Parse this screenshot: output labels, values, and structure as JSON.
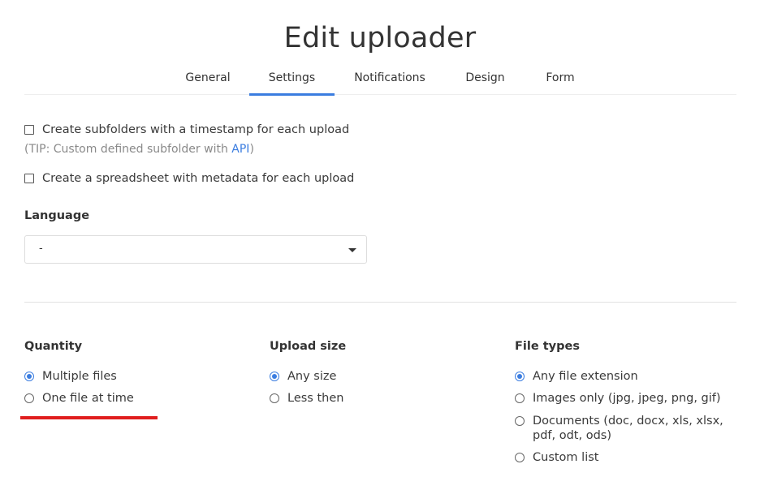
{
  "page": {
    "title": "Edit uploader"
  },
  "tabs": [
    {
      "label": "General",
      "active": false
    },
    {
      "label": "Settings",
      "active": true
    },
    {
      "label": "Notifications",
      "active": false
    },
    {
      "label": "Design",
      "active": false
    },
    {
      "label": "Form",
      "active": false
    }
  ],
  "settings": {
    "subfolders_checkbox": {
      "label": "Create subfolders with a timestamp for each upload",
      "checked": false
    },
    "tip": {
      "prefix": "(TIP: Custom defined subfolder with ",
      "link": "API",
      "suffix": ")"
    },
    "spreadsheet_checkbox": {
      "label": "Create a spreadsheet with metadata for each upload",
      "checked": false
    },
    "language": {
      "label": "Language",
      "value": "-"
    }
  },
  "quantity": {
    "label": "Quantity",
    "options": [
      {
        "label": "Multiple files",
        "checked": true
      },
      {
        "label": "One file at time",
        "checked": false
      }
    ]
  },
  "upload_size": {
    "label": "Upload size",
    "options": [
      {
        "label": "Any size",
        "checked": true
      },
      {
        "label": "Less then",
        "checked": false
      }
    ]
  },
  "file_types": {
    "label": "File types",
    "options": [
      {
        "label": "Any file extension",
        "checked": true
      },
      {
        "label": "Images only (jpg, jpeg, png, gif)",
        "checked": false
      },
      {
        "label": "Documents (doc, docx, xls, xlsx, pdf, odt, ods)",
        "checked": false
      },
      {
        "label": "Custom list",
        "checked": false
      }
    ]
  },
  "colors": {
    "accent": "#3b7de0",
    "annotation_red": "#e01e1e"
  }
}
